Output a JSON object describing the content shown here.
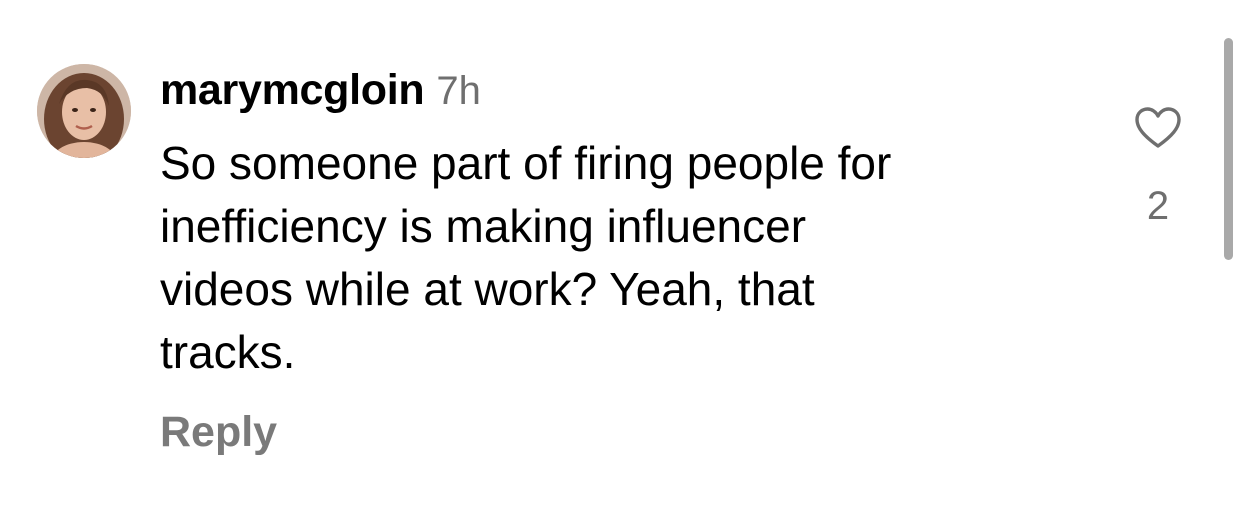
{
  "comment": {
    "username": "marymcgloin",
    "timestamp": "7h",
    "text_lines": [
      "So someone part of firing people for",
      "inefficiency is making influencer",
      "videos while at work? Yeah, that",
      "tracks."
    ],
    "reply_label": "Reply",
    "like_count": "2",
    "like_icon": "heart-outline-icon"
  },
  "colors": {
    "primary_text": "#000000",
    "secondary_text": "#6f6f6f",
    "reply_text": "#7a7a7a",
    "scrollbar": "#a9a9a9"
  }
}
